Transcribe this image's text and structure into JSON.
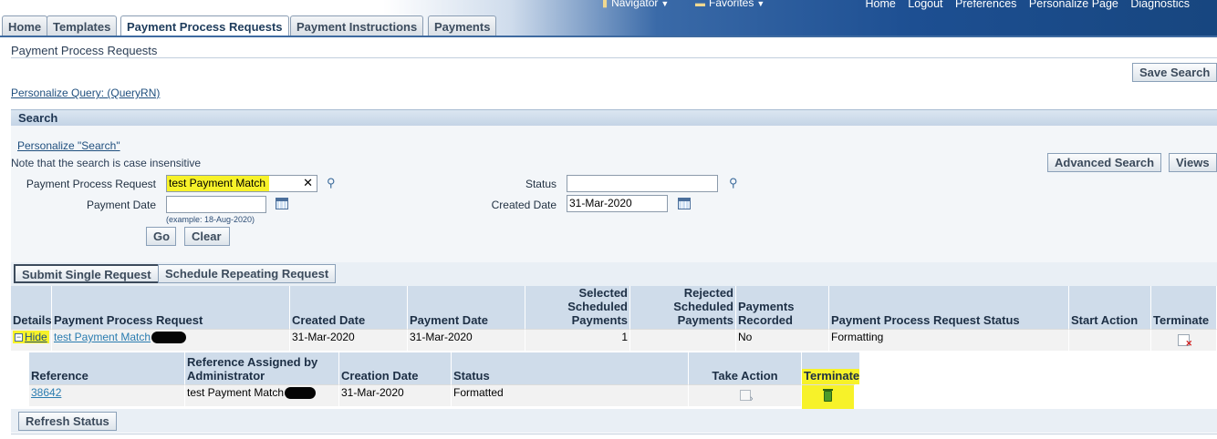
{
  "tabs": [
    "Home",
    "Templates",
    "Payment Process Requests",
    "Payment Instructions",
    "Payments"
  ],
  "global_menus": {
    "navigator": "Navigator",
    "favorites": "Favorites"
  },
  "global_links": [
    "Home",
    "Logout",
    "Preferences",
    "Personalize Page",
    "Diagnostics"
  ],
  "page_title": "Payment Process Requests",
  "save_search": "Save Search",
  "personalize_query": "Personalize Query: (QueryRN)",
  "search": {
    "header": "Search",
    "personalize": "Personalize \"Search\"",
    "note": "Note that the search is case insensitive",
    "advanced": "Advanced Search",
    "views": "Views",
    "ppr_label": "Payment Process Request",
    "ppr_value": "test Payment Match",
    "status_label": "Status",
    "status_value": "",
    "pay_date_label": "Payment Date",
    "pay_date_value": "",
    "pay_date_hint": "(example: 18-Aug-2020)",
    "created_label": "Created Date",
    "created_value": "31-Mar-2020",
    "go": "Go",
    "clear": "Clear"
  },
  "actions": {
    "submit_single": "Submit Single Request",
    "schedule_repeating": "Schedule Repeating Request"
  },
  "results": {
    "headers": {
      "details": "Details",
      "ppr": "Payment Process Request",
      "created": "Created Date",
      "payment_date": "Payment Date",
      "selected_1": "Selected",
      "selected_2": "Scheduled",
      "selected_3": "Payments",
      "rejected_1": "Rejected",
      "rejected_2": "Scheduled",
      "rejected_3": "Payments",
      "recorded_1": "Payments",
      "recorded_2": "Recorded",
      "ppr_status": "Payment Process Request Status",
      "start_action": "Start Action",
      "terminate": "Terminate"
    },
    "row": {
      "details": "Hide",
      "ppr": "test Payment Match",
      "created": "31-Mar-2020",
      "payment_date": "31-Mar-2020",
      "selected": "1",
      "rejected": "",
      "recorded": "No",
      "status": "Formatting"
    }
  },
  "detail": {
    "headers": {
      "reference": "Reference",
      "ref_admin_1": "Reference Assigned by",
      "ref_admin_2": "Administrator",
      "creation_date": "Creation Date",
      "status": "Status",
      "take_action": "Take Action",
      "terminate": "Terminate"
    },
    "row": {
      "reference": "38642",
      "ref_admin": "test Payment Match",
      "creation_date": "31-Mar-2020",
      "status": "Formatted"
    }
  },
  "refresh_status": "Refresh Status",
  "colors": {
    "highlight": "#f7f229",
    "header_bg": "#cfdcea",
    "banner": "#1d4f92",
    "link": "#1f4f7e"
  },
  "icons": [
    "search-icon",
    "calendar-icon",
    "expand-collapse-icon",
    "terminate-icon",
    "take-action-icon",
    "trash-icon"
  ]
}
